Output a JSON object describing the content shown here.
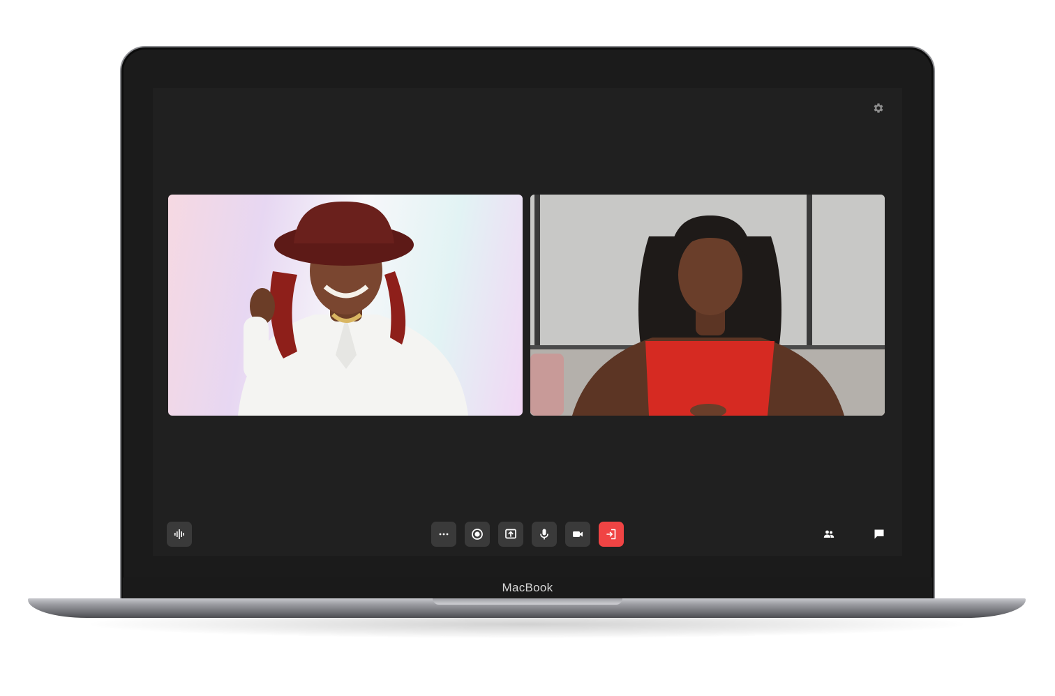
{
  "device": {
    "brand_label": "MacBook"
  },
  "call": {
    "participants": [
      {
        "id": "participant-1"
      },
      {
        "id": "participant-2"
      }
    ],
    "toolbar": {
      "left": [
        {
          "icon": "audio-waveform-icon"
        }
      ],
      "center": [
        {
          "icon": "more-options-icon"
        },
        {
          "icon": "record-icon"
        },
        {
          "icon": "screen-share-icon"
        },
        {
          "icon": "microphone-icon"
        },
        {
          "icon": "camera-icon"
        },
        {
          "icon": "leave-call-icon"
        }
      ],
      "right": [
        {
          "icon": "participants-icon"
        },
        {
          "icon": "chat-icon"
        }
      ]
    },
    "colors": {
      "background": "#202020",
      "button": "#3a3a3a",
      "leave_button": "#f04444",
      "icon": "#ffffff"
    }
  }
}
